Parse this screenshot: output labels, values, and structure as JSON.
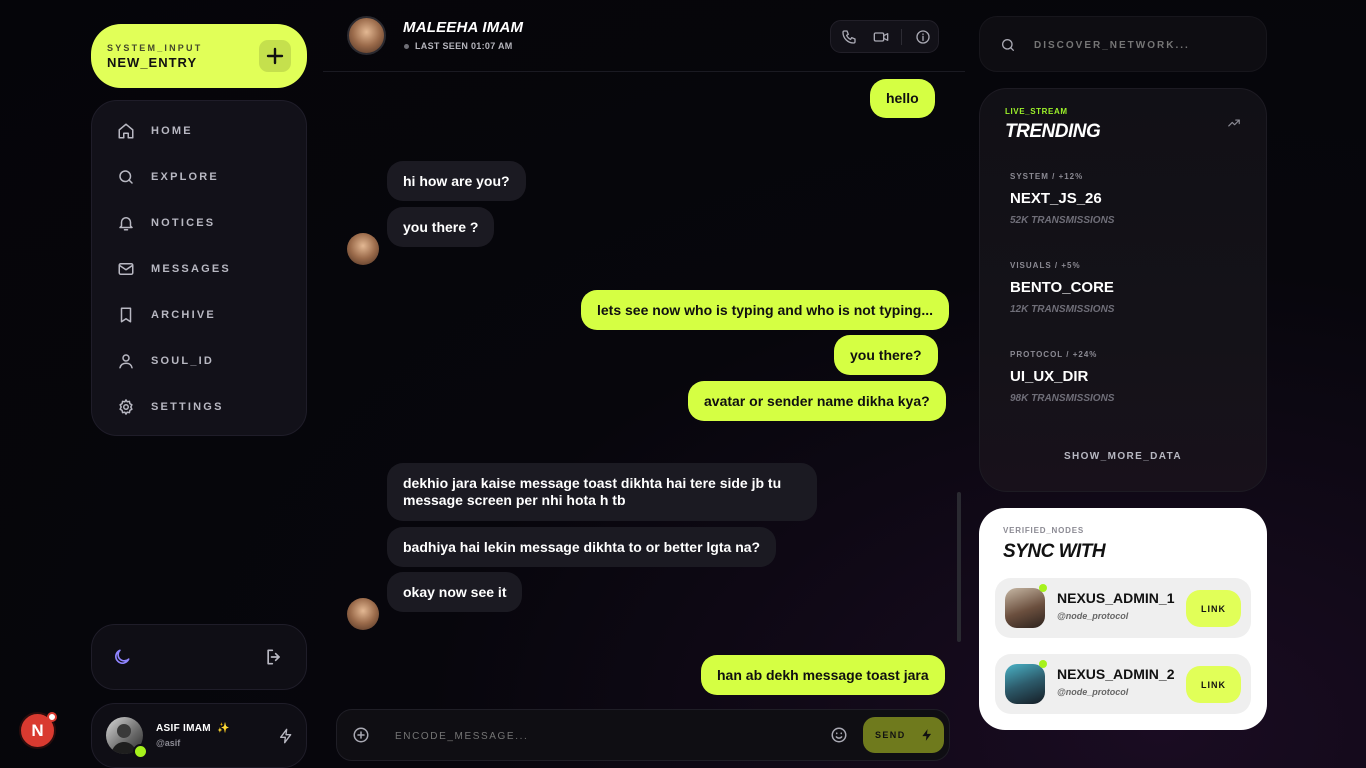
{
  "compose": {
    "caption": "SYSTEM_INPUT",
    "label": "NEW_ENTRY"
  },
  "nav": {
    "home": "HOME",
    "explore": "EXPLORE",
    "notices": "NOTICES",
    "messages": "MESSAGES",
    "archive": "ARCHIVE",
    "soul_id": "SOUL_ID",
    "settings": "SETTINGS"
  },
  "user": {
    "name": "ASIF IMAM",
    "badge": "✨",
    "handle": "@asif",
    "corner_initial": "N"
  },
  "chat": {
    "contact_name": "MALEEHA IMAM",
    "last_seen": "LAST SEEN 01:07 AM",
    "messages": [
      {
        "from": "me",
        "text": "hello"
      },
      {
        "from": "them",
        "text": "hi how are you?"
      },
      {
        "from": "them",
        "text": "you there ?"
      },
      {
        "from": "me",
        "text": "lets see now who is typing and who is not typing..."
      },
      {
        "from": "me",
        "text": "you there?"
      },
      {
        "from": "me",
        "text": "avatar or sender name dikha kya?"
      },
      {
        "from": "them",
        "text": "dekhio jara kaise message toast dikhta hai tere side jb tu message screen per nhi hota h tb"
      },
      {
        "from": "them",
        "text": "badhiya hai lekin message dikhta to or better lgta na?"
      },
      {
        "from": "them",
        "text": "okay now see it"
      },
      {
        "from": "me",
        "text": "han ab dekh message toast jara"
      }
    ],
    "composer_placeholder": "ENCODE_MESSAGE...",
    "send_label": "SEND"
  },
  "search": {
    "placeholder": "DISCOVER_NETWORK..."
  },
  "trending": {
    "caption": "LIVE_STREAM",
    "title": "TRENDING",
    "items": [
      {
        "category": "SYSTEM / +12%",
        "name": "NEXT_JS_26",
        "count": "52K TRANSMISSIONS"
      },
      {
        "category": "VISUALS / +5%",
        "name": "BENTO_CORE",
        "count": "12K TRANSMISSIONS"
      },
      {
        "category": "PROTOCOL / +24%",
        "name": "UI_UX_DIR",
        "count": "98K TRANSMISSIONS"
      }
    ],
    "show_more": "SHOW_MORE_DATA"
  },
  "sync": {
    "caption": "VERIFIED_NODES",
    "title": "SYNC WITH",
    "nodes": [
      {
        "name": "NEXUS_ADMIN_1",
        "handle": "@node_protocol",
        "action": "LINK"
      },
      {
        "name": "NEXUS_ADMIN_2",
        "handle": "@node_protocol",
        "action": "LINK"
      }
    ]
  },
  "colors": {
    "accent": "#e1ff58",
    "bubble_out": "#d5ff43",
    "bubble_in": "#1b1a22",
    "live_stream": "#9df22a",
    "moon_icon": "#8f84ff",
    "notification": "#d93a30"
  }
}
